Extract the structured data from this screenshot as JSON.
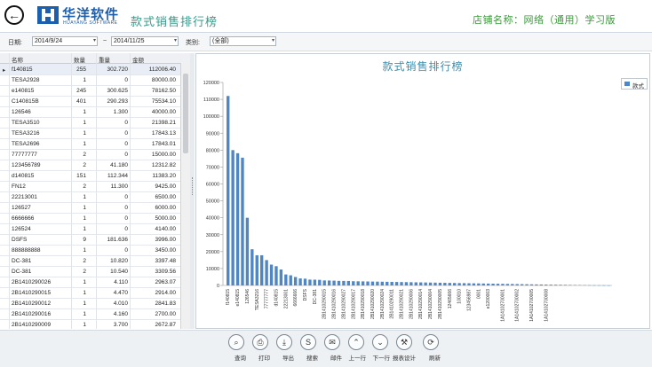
{
  "header": {
    "brand_name": "华洋软件",
    "brand_sub": "HUAYANG SOFTWARE",
    "title": "款式销售排行榜",
    "store_label": "店铺名称：网络（通用）学习版"
  },
  "filters": {
    "date_label": "日期:",
    "date_from": "2014/9/24",
    "date_sep": "~",
    "date_to": "2014/11/25",
    "category_label": "类别:",
    "category_value": "(全部)"
  },
  "table": {
    "columns": [
      "名称",
      "数量",
      "重量",
      "金额"
    ],
    "rows": [
      {
        "name": "f140815",
        "qty": "255",
        "weight": "302.720",
        "amount": "112006.40"
      },
      {
        "name": "TESA2928",
        "qty": "1",
        "weight": "0",
        "amount": "80000.00"
      },
      {
        "name": "e140815",
        "qty": "245",
        "weight": "300.625",
        "amount": "78162.50"
      },
      {
        "name": "C140815B",
        "qty": "401",
        "weight": "290.293",
        "amount": "75534.10"
      },
      {
        "name": "126546",
        "qty": "1",
        "weight": "1.300",
        "amount": "40000.00"
      },
      {
        "name": "TESA3510",
        "qty": "1",
        "weight": "0",
        "amount": "21398.21"
      },
      {
        "name": "TESA3216",
        "qty": "1",
        "weight": "0",
        "amount": "17843.13"
      },
      {
        "name": "TESA2696",
        "qty": "1",
        "weight": "0",
        "amount": "17843.01"
      },
      {
        "name": "77777777",
        "qty": "2",
        "weight": "0",
        "amount": "15000.00"
      },
      {
        "name": "123456789",
        "qty": "2",
        "weight": "41.180",
        "amount": "12312.82"
      },
      {
        "name": "d140815",
        "qty": "151",
        "weight": "112.344",
        "amount": "11383.20"
      },
      {
        "name": "FN12",
        "qty": "2",
        "weight": "11.300",
        "amount": "9425.00"
      },
      {
        "name": "22213001",
        "qty": "1",
        "weight": "0",
        "amount": "6500.00"
      },
      {
        "name": "126527",
        "qty": "1",
        "weight": "0",
        "amount": "6000.00"
      },
      {
        "name": "6666666",
        "qty": "1",
        "weight": "0",
        "amount": "5000.00"
      },
      {
        "name": "126524",
        "qty": "1",
        "weight": "0",
        "amount": "4140.00"
      },
      {
        "name": "DSFS",
        "qty": "9",
        "weight": "181.636",
        "amount": "3996.00"
      },
      {
        "name": "888888888",
        "qty": "1",
        "weight": "0",
        "amount": "3450.00"
      },
      {
        "name": "DC-381",
        "qty": "2",
        "weight": "10.820",
        "amount": "3397.48"
      },
      {
        "name": "DC-381",
        "qty": "2",
        "weight": "10.540",
        "amount": "3309.56"
      },
      {
        "name": "2B1410290026",
        "qty": "1",
        "weight": "4.110",
        "amount": "2963.07"
      },
      {
        "name": "2B1410290015",
        "qty": "1",
        "weight": "4.470",
        "amount": "2914.00"
      },
      {
        "name": "2B1410290012",
        "qty": "1",
        "weight": "4.010",
        "amount": "2841.83"
      },
      {
        "name": "2B1410290016",
        "qty": "1",
        "weight": "4.160",
        "amount": "2700.00"
      },
      {
        "name": "2B1410290009",
        "qty": "1",
        "weight": "3.700",
        "amount": "2672.87"
      },
      {
        "name": "2B1410290010",
        "qty": "1",
        "weight": "3.610",
        "amount": "2649.97"
      }
    ]
  },
  "chart_data": {
    "type": "bar",
    "title": "款式销售排行榜",
    "legend": [
      "款式"
    ],
    "legend_position": "top-right",
    "color": "#4f86c6",
    "ylim": [
      0,
      120000
    ],
    "yticks": [
      0,
      10000,
      20000,
      30000,
      40000,
      50000,
      60000,
      70000,
      80000,
      90000,
      100000,
      110000,
      120000
    ],
    "grid": false,
    "values": [
      112006.4,
      80000,
      78162.5,
      75534.1,
      40000,
      21398.21,
      17843.13,
      17843.01,
      15000,
      12312.82,
      11383.2,
      9425,
      6500,
      6000,
      5000,
      4140,
      3996,
      3450,
      3397.48,
      3309.56,
      2963.07,
      2914,
      2841.83,
      2700,
      2672.87,
      2649.97,
      2500,
      2450,
      2400,
      2350,
      2300,
      2250,
      2200,
      2150,
      2100,
      2050,
      2000,
      1950,
      1900,
      1850,
      1800,
      1750,
      1700,
      1650,
      1600,
      1550,
      1500,
      1450,
      1400,
      1350,
      1300,
      1250,
      1200,
      1150,
      1100,
      1050,
      1000,
      950,
      900,
      850,
      800,
      750,
      700,
      650,
      600,
      550,
      500,
      460,
      420,
      380,
      340,
      300,
      260,
      220,
      180,
      140,
      100,
      80,
      60,
      40
    ],
    "x_tick_labels": [
      {
        "index": 0,
        "label": "f140815"
      },
      {
        "index": 2,
        "label": "e140815"
      },
      {
        "index": 4,
        "label": "126546"
      },
      {
        "index": 6,
        "label": "TESA3216"
      },
      {
        "index": 8,
        "label": "77777777"
      },
      {
        "index": 10,
        "label": "d140815"
      },
      {
        "index": 12,
        "label": "22213001"
      },
      {
        "index": 14,
        "label": "6666666"
      },
      {
        "index": 16,
        "label": "DSFS"
      },
      {
        "index": 18,
        "label": "DC-381"
      },
      {
        "index": 20,
        "label": "2B1410290015"
      },
      {
        "index": 22,
        "label": "2B1410290016"
      },
      {
        "index": 24,
        "label": "2B1410290027"
      },
      {
        "index": 26,
        "label": "2B1410290017"
      },
      {
        "index": 28,
        "label": "2B1410290018"
      },
      {
        "index": 30,
        "label": "2B1410290020"
      },
      {
        "index": 32,
        "label": "2B1410290024"
      },
      {
        "index": 34,
        "label": "2B1410290011"
      },
      {
        "index": 36,
        "label": "2B1410290021"
      },
      {
        "index": 38,
        "label": "2B1410290006"
      },
      {
        "index": 40,
        "label": "2B1410290014"
      },
      {
        "index": 42,
        "label": "2B1410290004"
      },
      {
        "index": 44,
        "label": "2B1410290005"
      },
      {
        "index": 46,
        "label": "12465666"
      },
      {
        "index": 48,
        "label": "100010"
      },
      {
        "index": 50,
        "label": "123456987"
      },
      {
        "index": 52,
        "label": "0001"
      },
      {
        "index": 54,
        "label": "e1200003"
      },
      {
        "index": 57,
        "label": "1A14102700001"
      },
      {
        "index": 60,
        "label": "1A14102700002"
      },
      {
        "index": 63,
        "label": "1A14102700005"
      },
      {
        "index": 66,
        "label": "1A14102700008"
      }
    ]
  },
  "toolbar": {
    "buttons": [
      {
        "label": "查询",
        "icon": "search-icon"
      },
      {
        "label": "打印",
        "icon": "printer-icon"
      },
      {
        "label": "导出",
        "icon": "export-icon"
      },
      {
        "label": "搜索",
        "icon": "skype-icon"
      },
      {
        "label": "邮件",
        "icon": "mail-icon"
      },
      {
        "label": "上一行",
        "icon": "chevron-up-icon"
      },
      {
        "label": "下一行",
        "icon": "chevron-down-icon"
      },
      {
        "label": "报表设计",
        "icon": "hammer-icon"
      },
      {
        "label": "刷新",
        "icon": "refresh-icon"
      }
    ]
  }
}
